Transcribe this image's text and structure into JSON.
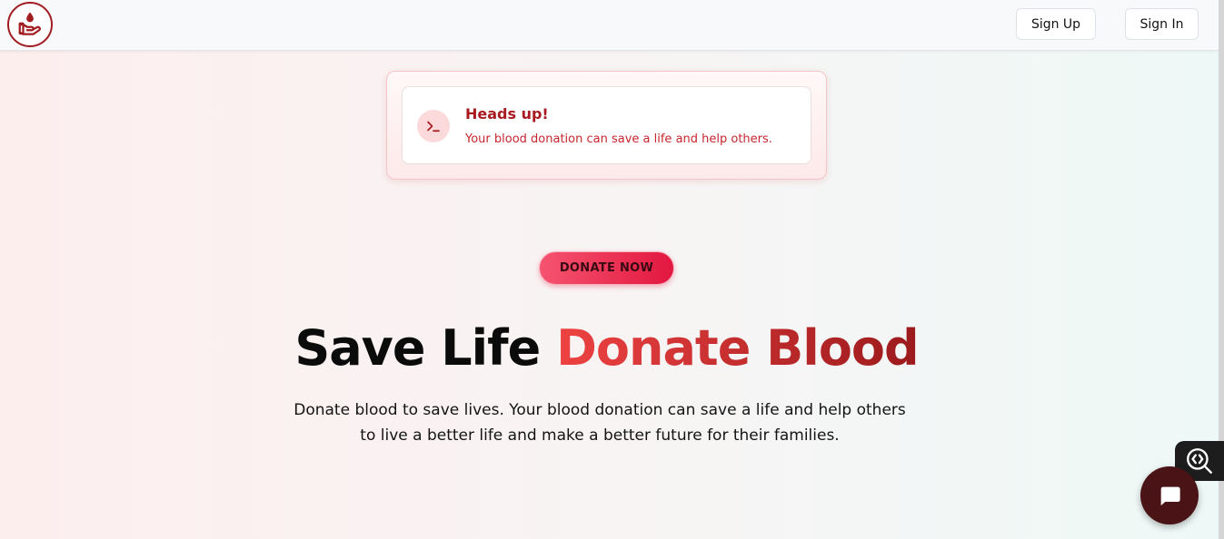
{
  "header": {
    "logo_icon": "blood-drop-hand-icon",
    "signup_label": "Sign Up",
    "signin_label": "Sign In"
  },
  "alert": {
    "icon": "terminal-icon",
    "title": "Heads up!",
    "description": "Your blood donation can save a life and help others."
  },
  "donate_button": {
    "label": "DONATE NOW"
  },
  "hero": {
    "title_plain": "Save Life ",
    "title_accent": "Donate Blood",
    "description": "Donate blood to save lives. Your blood donation can save a life and help others to live a better life and make a better future for their families."
  },
  "widgets": {
    "inspect_icon": "code-inspect-icon",
    "chat_icon": "chat-bubble-icon"
  },
  "colors": {
    "brand_red": "#a81a1f",
    "accent_red": "#e2173f",
    "chat_bg": "#4a1416"
  }
}
